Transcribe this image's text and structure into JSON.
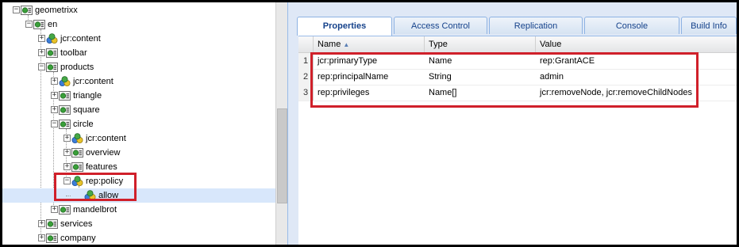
{
  "tree": {
    "nodes": [
      {
        "label": "geometrixx",
        "depth": 0,
        "state": "minus",
        "icon": "folder-node-icon"
      },
      {
        "label": "en",
        "depth": 1,
        "state": "minus",
        "icon": "folder-node-icon"
      },
      {
        "label": "jcr:content",
        "depth": 2,
        "state": "plus",
        "icon": "content-node-icon"
      },
      {
        "label": "toolbar",
        "depth": 2,
        "state": "plus",
        "icon": "folder-node-icon"
      },
      {
        "label": "products",
        "depth": 2,
        "state": "minus",
        "icon": "folder-node-icon"
      },
      {
        "label": "jcr:content",
        "depth": 3,
        "state": "plus",
        "icon": "content-node-icon"
      },
      {
        "label": "triangle",
        "depth": 3,
        "state": "plus",
        "icon": "folder-node-icon"
      },
      {
        "label": "square",
        "depth": 3,
        "state": "plus",
        "icon": "folder-node-icon"
      },
      {
        "label": "circle",
        "depth": 3,
        "state": "minus",
        "icon": "folder-node-icon"
      },
      {
        "label": "jcr:content",
        "depth": 4,
        "state": "plus",
        "icon": "content-node-icon"
      },
      {
        "label": "overview",
        "depth": 4,
        "state": "plus",
        "icon": "folder-node-icon"
      },
      {
        "label": "features",
        "depth": 4,
        "state": "plus",
        "icon": "folder-node-icon"
      },
      {
        "label": "rep:policy",
        "depth": 4,
        "state": "minus",
        "icon": "content-node-icon"
      },
      {
        "label": "allow",
        "depth": 5,
        "state": "none",
        "icon": "content-node-icon",
        "selected": true
      },
      {
        "label": "mandelbrot",
        "depth": 3,
        "state": "plus",
        "icon": "folder-node-icon"
      },
      {
        "label": "services",
        "depth": 2,
        "state": "plus",
        "icon": "folder-node-icon"
      },
      {
        "label": "company",
        "depth": 2,
        "state": "plus",
        "icon": "folder-node-icon"
      }
    ]
  },
  "tabs": [
    {
      "label": "Properties",
      "active": true
    },
    {
      "label": "Access Control",
      "active": false
    },
    {
      "label": "Replication",
      "active": false
    },
    {
      "label": "Console",
      "active": false
    },
    {
      "label": "Build Info",
      "active": false
    }
  ],
  "grid": {
    "columns": {
      "name": "Name",
      "type": "Type",
      "value": "Value"
    },
    "sort_indicator": "▲",
    "rows": [
      {
        "num": "1",
        "name": "jcr:primaryType",
        "type": "Name",
        "value": "rep:GrantACE"
      },
      {
        "num": "2",
        "name": "rep:principalName",
        "type": "String",
        "value": "admin"
      },
      {
        "num": "3",
        "name": "rep:privileges",
        "type": "Name[]",
        "value": "jcr:removeNode, jcr:removeChildNodes"
      }
    ]
  },
  "colors": {
    "highlight": "#d0202a",
    "selection": "#d8e7fb",
    "tab_text": "#15428b"
  }
}
